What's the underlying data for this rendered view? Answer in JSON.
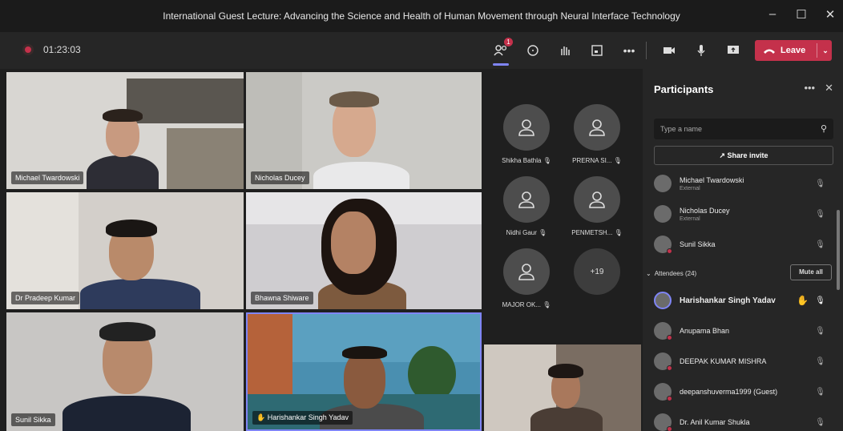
{
  "window": {
    "title": "International Guest Lecture: Advancing the Science and Health of Human Movement through Neural Interface Technology",
    "minimize": "–",
    "maximize": "☐",
    "close": "✕"
  },
  "toolbar": {
    "timer": "01:23:03",
    "participants_badge": "1",
    "more": "•••",
    "leave_label": "Leave"
  },
  "video_tiles": [
    {
      "name": "Michael Twardowski"
    },
    {
      "name": "Nicholas Ducey"
    },
    {
      "name": "Dr Pradeep Kumar"
    },
    {
      "name": "Bhawna Shiware"
    },
    {
      "name": "Sunil Sikka"
    },
    {
      "name": "Harishankar Singh Yadav"
    }
  ],
  "avatar_grid": [
    {
      "name": "Shikha Bathla"
    },
    {
      "name": "PRERNA SI..."
    },
    {
      "name": "Nidhi Gaur"
    },
    {
      "name": "PENMETSH..."
    },
    {
      "name": "MAJOR OK..."
    }
  ],
  "more_count": "+19",
  "panel": {
    "title": "Participants",
    "more": "•••",
    "close": "✕",
    "search_placeholder": "Type a name",
    "share_label": "Share invite",
    "attendees_label": "Attendees (24)",
    "mute_all": "Mute all",
    "presenters": [
      {
        "name": "Michael Twardowski",
        "sub": "External"
      },
      {
        "name": "Nicholas Ducey",
        "sub": "External"
      },
      {
        "name": "Sunil Sikka",
        "sub": ""
      }
    ],
    "attendees": [
      {
        "name": "Harishankar Singh Yadav"
      },
      {
        "name": "Anupama Bhan"
      },
      {
        "name": "DEEPAK KUMAR MISHRA"
      },
      {
        "name": "deepanshuverma1999 (Guest)"
      },
      {
        "name": "Dr. Anil Kumar Shukla"
      }
    ]
  },
  "colors": {
    "accent": "#7f85f5",
    "leave": "#c4314b",
    "raise_hand": "#f4b400"
  }
}
